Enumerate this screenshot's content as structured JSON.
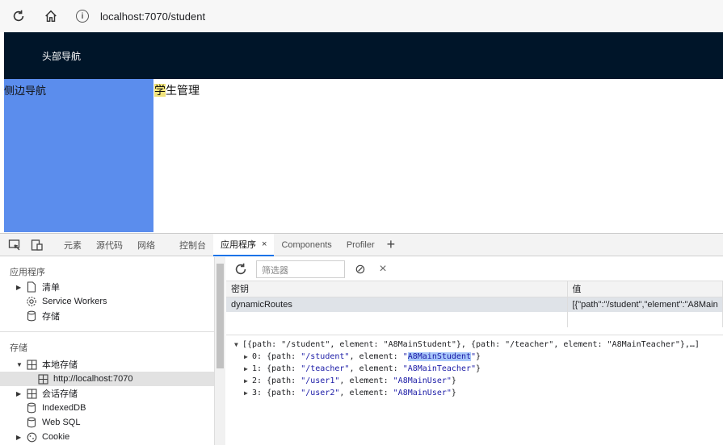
{
  "browser": {
    "url": "localhost:7070/student",
    "icons": [
      "reload-icon",
      "home-icon",
      "info-icon"
    ]
  },
  "page": {
    "top_nav": "头部导航",
    "side_nav": "侧边导航",
    "main_title_first": "学",
    "main_title_rest": "生管理"
  },
  "devtools": {
    "tabs": [
      {
        "label": "元素"
      },
      {
        "label": "源代码"
      },
      {
        "label": "网络"
      },
      {
        "label": "控制台"
      },
      {
        "label": "应用程序",
        "close": "×"
      },
      {
        "label": "Components"
      },
      {
        "label": "Profiler"
      }
    ],
    "add_tab": "+",
    "sidebar": {
      "app_section": "应用程序",
      "app_items": [
        "清单",
        "Service Workers",
        "存储"
      ],
      "storage_section": "存储",
      "local_storage": "本地存储",
      "local_origin": "http://localhost:7070",
      "session_storage": "会话存储",
      "indexeddb": "IndexedDB",
      "websql": "Web SQL",
      "cookie": "Cookie"
    },
    "toolbar": {
      "filter_placeholder": "筛选器",
      "clear": "⊘",
      "delete": "×"
    },
    "table": {
      "key_header": "密钥",
      "value_header": "值",
      "rows": [
        {
          "key": "dynamicRoutes",
          "value": "[{\"path\":\"/student\",\"element\":\"A8Main"
        }
      ]
    },
    "preview": {
      "summary": "[{path: \"/student\", element: \"A8MainStudent\"}, {path: \"/teacher\", element: \"A8MainTeacher\"},…]",
      "items": [
        {
          "idx": "0",
          "path": "/student",
          "element": "A8MainStudent"
        },
        {
          "idx": "1",
          "path": "/teacher",
          "element": "A8MainTeacher"
        },
        {
          "idx": "2",
          "path": "/user1",
          "element": "A8MainUser"
        },
        {
          "idx": "3",
          "path": "/user2",
          "element": "A8MainUser"
        }
      ]
    }
  }
}
